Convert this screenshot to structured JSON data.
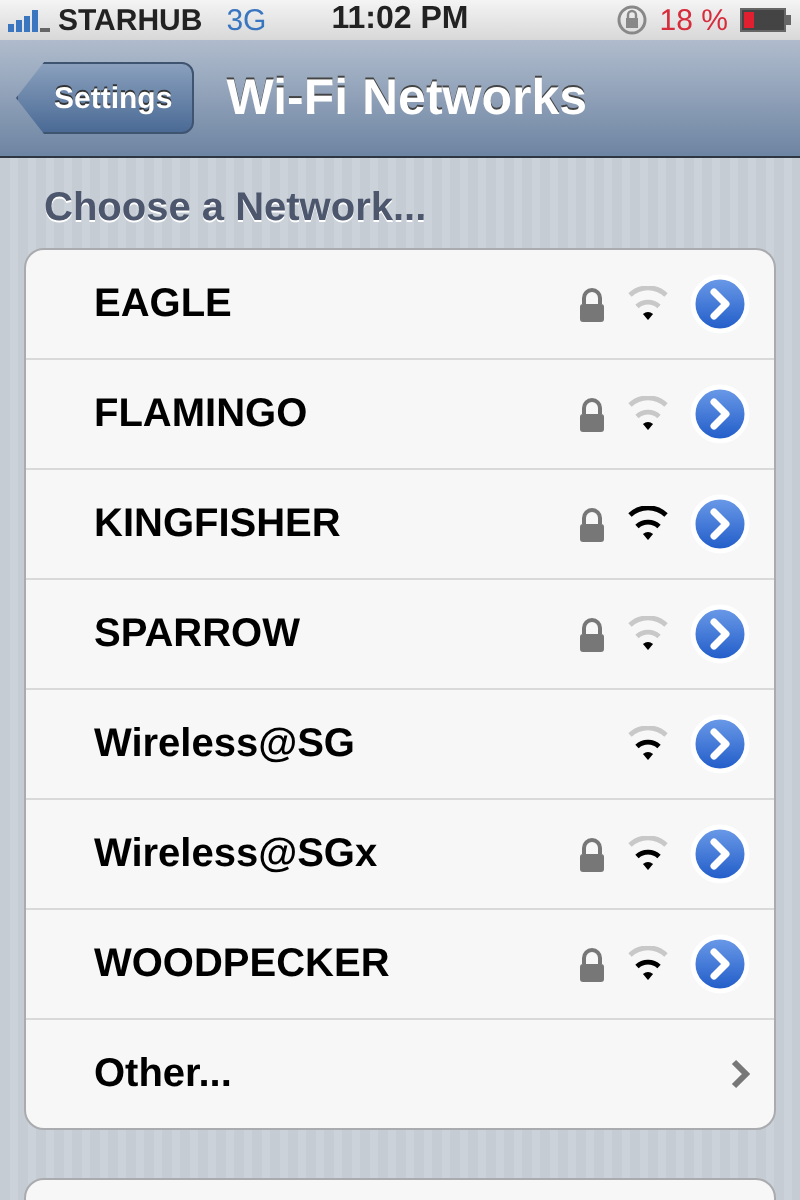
{
  "status_bar": {
    "carrier": "STARHUB",
    "network": "3G",
    "time": "11:02 PM",
    "battery": "18 %"
  },
  "nav_bar": {
    "back": "Settings",
    "title": "Wi-Fi Networks"
  },
  "section": {
    "header": "Choose a Network..."
  },
  "networks": [
    {
      "kind": "network",
      "name": "EAGLE",
      "locked": true
    },
    {
      "kind": "network",
      "name": "FLAMINGO",
      "locked": true
    },
    {
      "kind": "network",
      "name": "KINGFISHER",
      "locked": true
    },
    {
      "kind": "network",
      "name": "SPARROW",
      "locked": true
    },
    {
      "kind": "network",
      "name": "Wireless@SG",
      "locked": false
    },
    {
      "kind": "network",
      "name": "Wireless@SGx",
      "locked": true
    },
    {
      "kind": "network",
      "name": "WOODPECKER",
      "locked": true
    },
    {
      "kind": "other",
      "name": "Other..."
    }
  ]
}
